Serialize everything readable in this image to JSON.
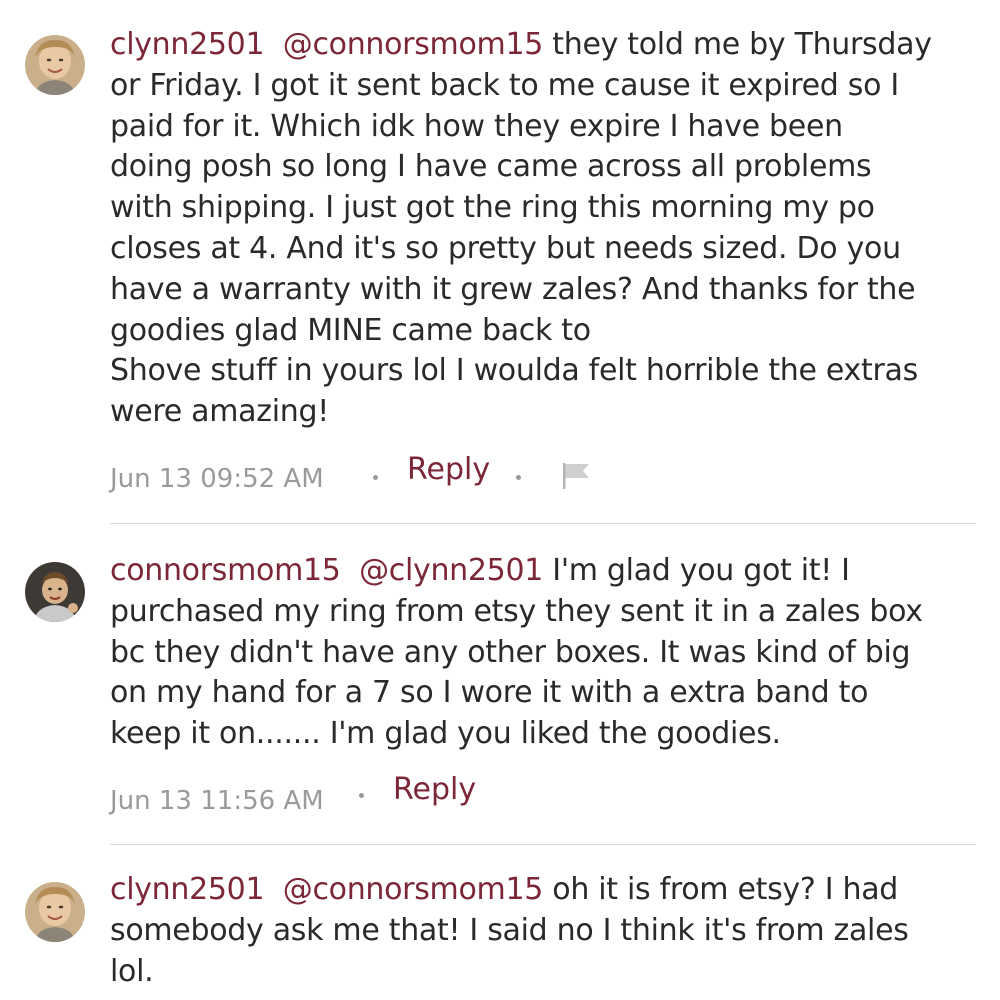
{
  "comments": [
    {
      "username": "clynn2501",
      "mention": "@connorsmom15",
      "lines_after_mention_first": " they told me by Thursday",
      "lines": [
        "or Friday. I got it sent back to me cause it expired so I",
        "paid for it. Which idk how they expire I have been",
        "doing posh so long I have came across all problems",
        "with shipping. I just got the ring this morning my po",
        "closes at 4. And it's so pretty but needs sized. Do you",
        "have a warranty with it grew zales? And thanks for the",
        "goodies glad MINE came back to",
        "Shove stuff in yours lol I woulda felt horrible the extras",
        "were amazing!"
      ],
      "timestamp": "Jun 13 09:52 AM",
      "reply_label": "Reply",
      "avatar_icon": "user-avatar-photo",
      "flag_icon": "flag-icon"
    },
    {
      "username": "connorsmom15",
      "mention": "@clynn2501",
      "lines_after_mention_first": " I'm glad you got it! I",
      "lines": [
        "purchased my ring from etsy they sent it in a zales box",
        "bc they didn't have any other boxes. It was kind of big",
        "on my hand for a 7 so I wore it with a extra band to",
        "keep it on....... I'm glad you liked the goodies."
      ],
      "timestamp": "Jun 13 11:56 AM",
      "reply_label": "Reply",
      "avatar_icon": "user-avatar-photo"
    },
    {
      "username": "clynn2501",
      "mention": "@connorsmom15",
      "lines_after_mention_first": " oh it is from etsy? I had",
      "lines": [
        "somebody ask me that! I said no I think it's from zales",
        "lol."
      ],
      "avatar_icon": "user-avatar-photo"
    }
  ],
  "colors": {
    "accent": "#7c2738",
    "text": "#2a2a2a",
    "muted": "#9a9a9a",
    "divider": "#d8d8d8"
  }
}
